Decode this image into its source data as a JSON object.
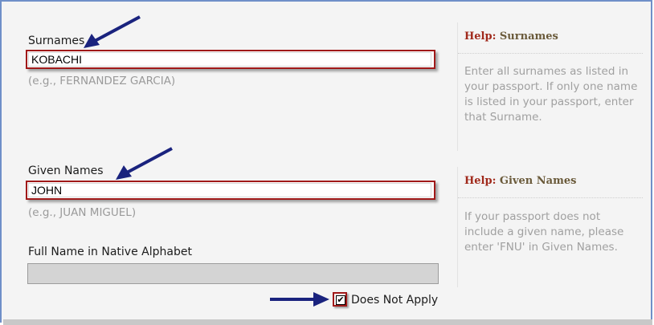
{
  "form": {
    "surnames": {
      "label": "Surnames",
      "value": "KOBACHI",
      "example": "(e.g., FERNANDEZ GARCIA)"
    },
    "given_names": {
      "label": "Given Names",
      "value": "JOHN",
      "example": "(e.g., JUAN MIGUEL)"
    },
    "native_name": {
      "label": "Full Name in Native Alphabet",
      "value": ""
    },
    "does_not_apply": {
      "label": "Does Not Apply",
      "checked": true
    }
  },
  "help": {
    "surnames": {
      "prefix": "Help:",
      "title": "Surnames",
      "body": "Enter all surnames as listed in your passport. If only one name is listed in your passport, enter that Surname."
    },
    "given_names": {
      "prefix": "Help:",
      "title": "Given Names",
      "body": "If your passport does not include a given name, please enter 'FNU' in Given Names."
    }
  },
  "colors": {
    "highlight_border": "#a01919",
    "arrow": "#1a237e",
    "frame": "#6f8fc8"
  }
}
